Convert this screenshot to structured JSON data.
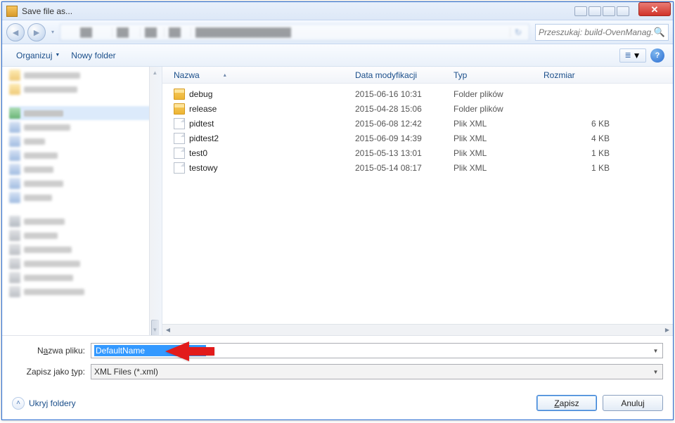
{
  "title": "Save file as...",
  "search": {
    "placeholder": "Przeszukaj: build-OvenManag..."
  },
  "toolbar": {
    "organize": "Organizuj",
    "new_folder": "Nowy folder"
  },
  "columns": {
    "name": "Nazwa",
    "date": "Data modyfikacji",
    "type": "Typ",
    "size": "Rozmiar"
  },
  "files": [
    {
      "icon": "folder",
      "name": "debug",
      "date": "2015-06-16 10:31",
      "type": "Folder plików",
      "size": ""
    },
    {
      "icon": "folder",
      "name": "release",
      "date": "2015-04-28 15:06",
      "type": "Folder plików",
      "size": ""
    },
    {
      "icon": "file",
      "name": "pidtest",
      "date": "2015-06-08 12:42",
      "type": "Plik XML",
      "size": "6 KB"
    },
    {
      "icon": "file",
      "name": "pidtest2",
      "date": "2015-06-09 14:39",
      "type": "Plik XML",
      "size": "4 KB"
    },
    {
      "icon": "file",
      "name": "test0",
      "date": "2015-05-13 13:01",
      "type": "Plik XML",
      "size": "1 KB"
    },
    {
      "icon": "file",
      "name": "testowy",
      "date": "2015-05-14 08:17",
      "type": "Plik XML",
      "size": "1 KB"
    }
  ],
  "labels": {
    "filename_pre": "N",
    "filename_ul": "a",
    "filename_post": "zwa pliku:",
    "saveas_pre": "Zapisz jako ",
    "saveas_ul": "t",
    "saveas_post": "yp:"
  },
  "filename_value": "DefaultName",
  "filetype_value": "XML Files (*.xml)",
  "footer": {
    "hide_folders": "Ukryj foldery",
    "save_pre": "",
    "save_ul": "Z",
    "save_post": "apisz",
    "cancel": "Anuluj"
  }
}
